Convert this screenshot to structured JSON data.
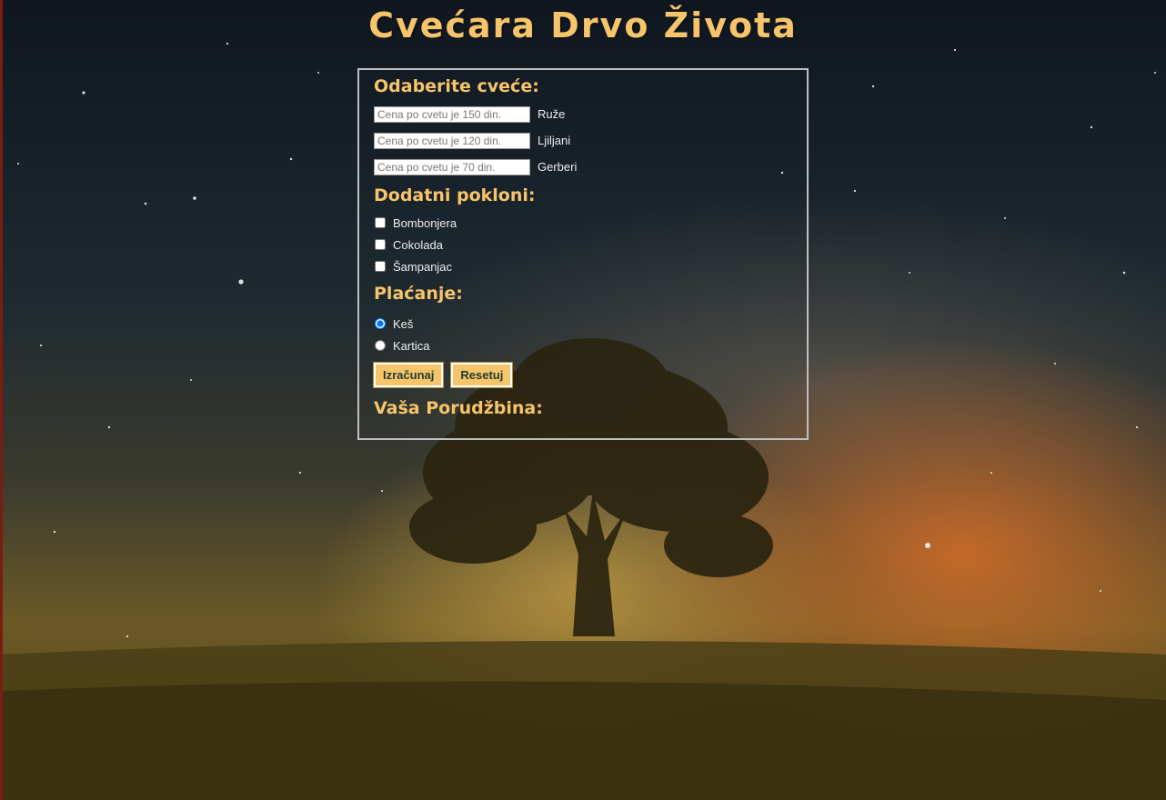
{
  "header": {
    "title": "Cvećara Drvo Života"
  },
  "sections": {
    "flowers_title": "Odaberite cveće:",
    "gifts_title": "Dodatni pokloni:",
    "payment_title": "Plaćanje:",
    "order_title": "Vaša Porudžbina:"
  },
  "flowers": [
    {
      "placeholder": "Cena po cvetu je 150 din.",
      "label": "Ruže"
    },
    {
      "placeholder": "Cena po cvetu je 120 din.",
      "label": "Ljiljani"
    },
    {
      "placeholder": "Cena po cvetu je 70 din.",
      "label": "Gerberi"
    }
  ],
  "gifts": [
    {
      "label": "Bombonjera",
      "checked": false
    },
    {
      "label": "Cokolada",
      "checked": false
    },
    {
      "label": "Šampanjac",
      "checked": false
    }
  ],
  "payment": [
    {
      "label": "Keš",
      "checked": true
    },
    {
      "label": "Kartica",
      "checked": false
    }
  ],
  "buttons": {
    "calculate": "Izračunaj",
    "reset": "Resetuj"
  },
  "colors": {
    "accent": "#f6c46a",
    "button_text": "#1f3b2f",
    "border": "#bfbfbf"
  }
}
